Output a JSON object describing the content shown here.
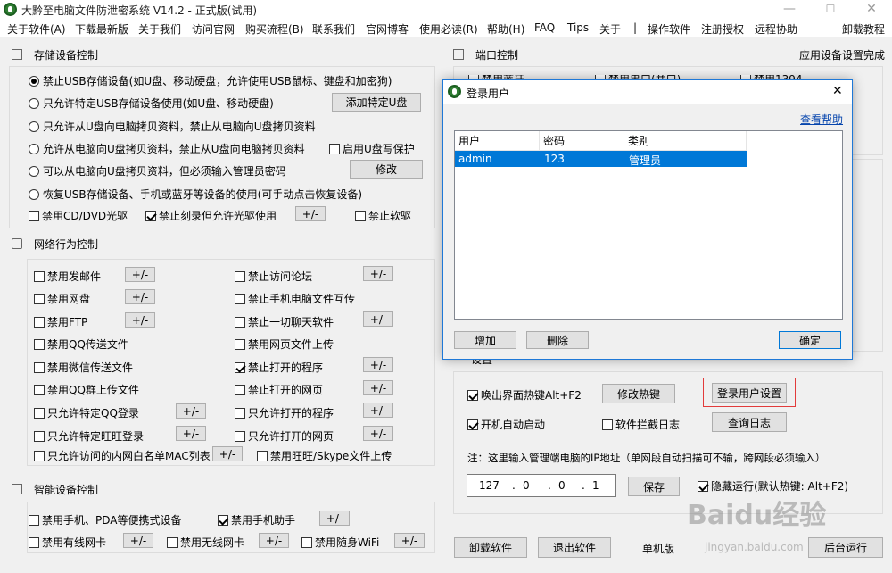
{
  "window": {
    "title": "大黔至电脑文件防泄密系统 V14.2 - 正式版(试用)",
    "minimize": "—",
    "maximize": "☐",
    "close": "✕"
  },
  "menu": [
    "关于软件(A)",
    "下载最新版",
    "关于我们",
    "访问官网",
    "购买流程(B)",
    "联系我们",
    "官网博客",
    "使用必读(R)",
    "帮助(H)",
    "FAQ",
    "Tips",
    "关于",
    "|",
    "操作软件",
    "注册授权",
    "远程协助",
    "卸载教程"
  ],
  "storage": {
    "title": "存储设备控制",
    "radios": [
      "禁止USB存储设备(如U盘、移动硬盘，允许使用USB鼠标、键盘和加密狗)",
      "只允许特定USB存储设备使用(如U盘、移动硬盘)",
      "只允许从U盘向电脑拷贝资料，禁止从电脑向U盘拷贝资料",
      "允许从电脑向U盘拷贝资料，禁止从U盘向电脑拷贝资料",
      "可以从电脑向U盘拷贝资料，但必须输入管理员密码",
      "恢复USB存储设备、手机或蓝牙等设备的使用(可手动点击恢复设备)"
    ],
    "add_usb_button": "添加特定U盘",
    "write_protect": "启用U盘写保护",
    "modify_button": "修改",
    "cd": "禁用CD/DVD光驱",
    "burn": "禁止刻录但允许光驱使用",
    "pm": "+/-",
    "floppy": "禁止软驱"
  },
  "network": {
    "title": "网络行为控制",
    "left": [
      "禁用发邮件",
      "禁用网盘",
      "禁用FTP",
      "禁用QQ传送文件",
      "禁用微信传送文件",
      "禁用QQ群上传文件",
      "只允许特定QQ登录",
      "只允许特定旺旺登录",
      "只允许访问的内网白名单MAC列表"
    ],
    "right": [
      "禁止访问论坛",
      "禁止手机电脑文件互传",
      "禁止一切聊天软件",
      "禁用网页文件上传",
      "禁止打开的程序",
      "禁止打开的网页",
      "只允许打开的程序",
      "只允许打开的网页",
      "禁用旺旺/Skype文件上传"
    ]
  },
  "smart": {
    "title": "智能设备控制",
    "phone_pda": "禁用手机、PDA等便携式设备",
    "phone_assist": "禁用手机助手",
    "wired": "禁用有线网卡",
    "wireless": "禁用无线网卡",
    "wifi": "禁用随身WiFi"
  },
  "port": {
    "title": "端口控制",
    "status": "应用设备设置完成",
    "item1": "禁用蓝牙",
    "item2": "禁用串口(并口)",
    "item3": "禁用1394"
  },
  "settings": {
    "title": "设置",
    "hotkey": "唤出界面热键Alt+F2",
    "modify_hotkey": "修改热键",
    "login_user_settings": "登录用户设置",
    "autostart": "开机自动启动",
    "intercept_log": "软件拦截日志",
    "query_log": "查询日志",
    "ip_note": "注：这里输入管理端电脑的IP地址（单网段自动扫描可不输，跨网段必须输入）",
    "ip": [
      "127",
      "0",
      "0",
      "1"
    ],
    "save": "保存",
    "hidden": "隐藏运行(默认热键: Alt+F2)"
  },
  "bottom": {
    "uninstall": "卸载软件",
    "exit": "退出软件",
    "mode": "单机版",
    "background": "后台运行"
  },
  "dialog": {
    "title": "登录用户",
    "help": "查看帮助",
    "columns": [
      "用户",
      "密码",
      "类别"
    ],
    "rows": [
      [
        "admin",
        "123",
        "管理员"
      ]
    ],
    "add": "增加",
    "delete": "删除",
    "ok": "确定",
    "close": "✕"
  },
  "watermark": {
    "logo": "Baidu经验",
    "url": "jingyan.baidu.com"
  },
  "colors": {
    "selection": "#0078d7",
    "link": "#0645ad",
    "highlight_box": "#e23b3b"
  }
}
